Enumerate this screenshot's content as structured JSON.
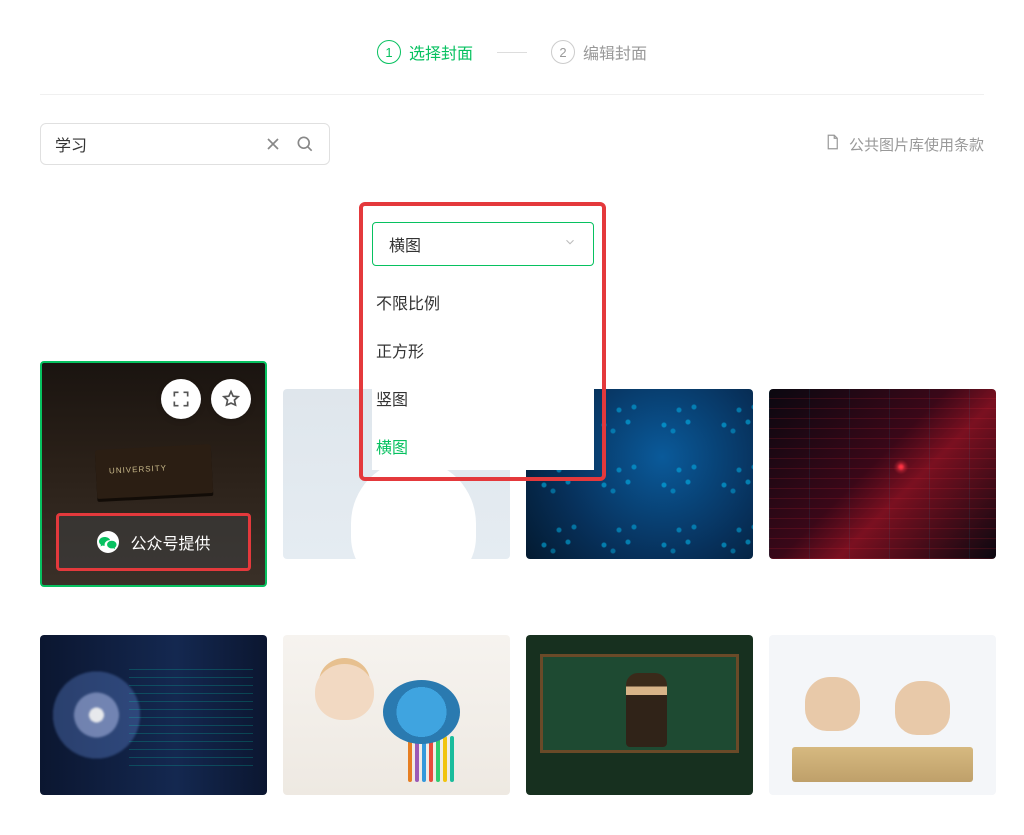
{
  "steps": {
    "one_num": "1",
    "one_label": "选择封面",
    "two_num": "2",
    "two_label": "编辑封面"
  },
  "search": {
    "value": "学习"
  },
  "ratio_select": {
    "value": "横图",
    "options": {
      "any": "不限比例",
      "square": "正方形",
      "portrait": "竖图",
      "landscape": "横图"
    }
  },
  "terms_link": "公共图片库使用条款",
  "provider_label": "公众号提供"
}
